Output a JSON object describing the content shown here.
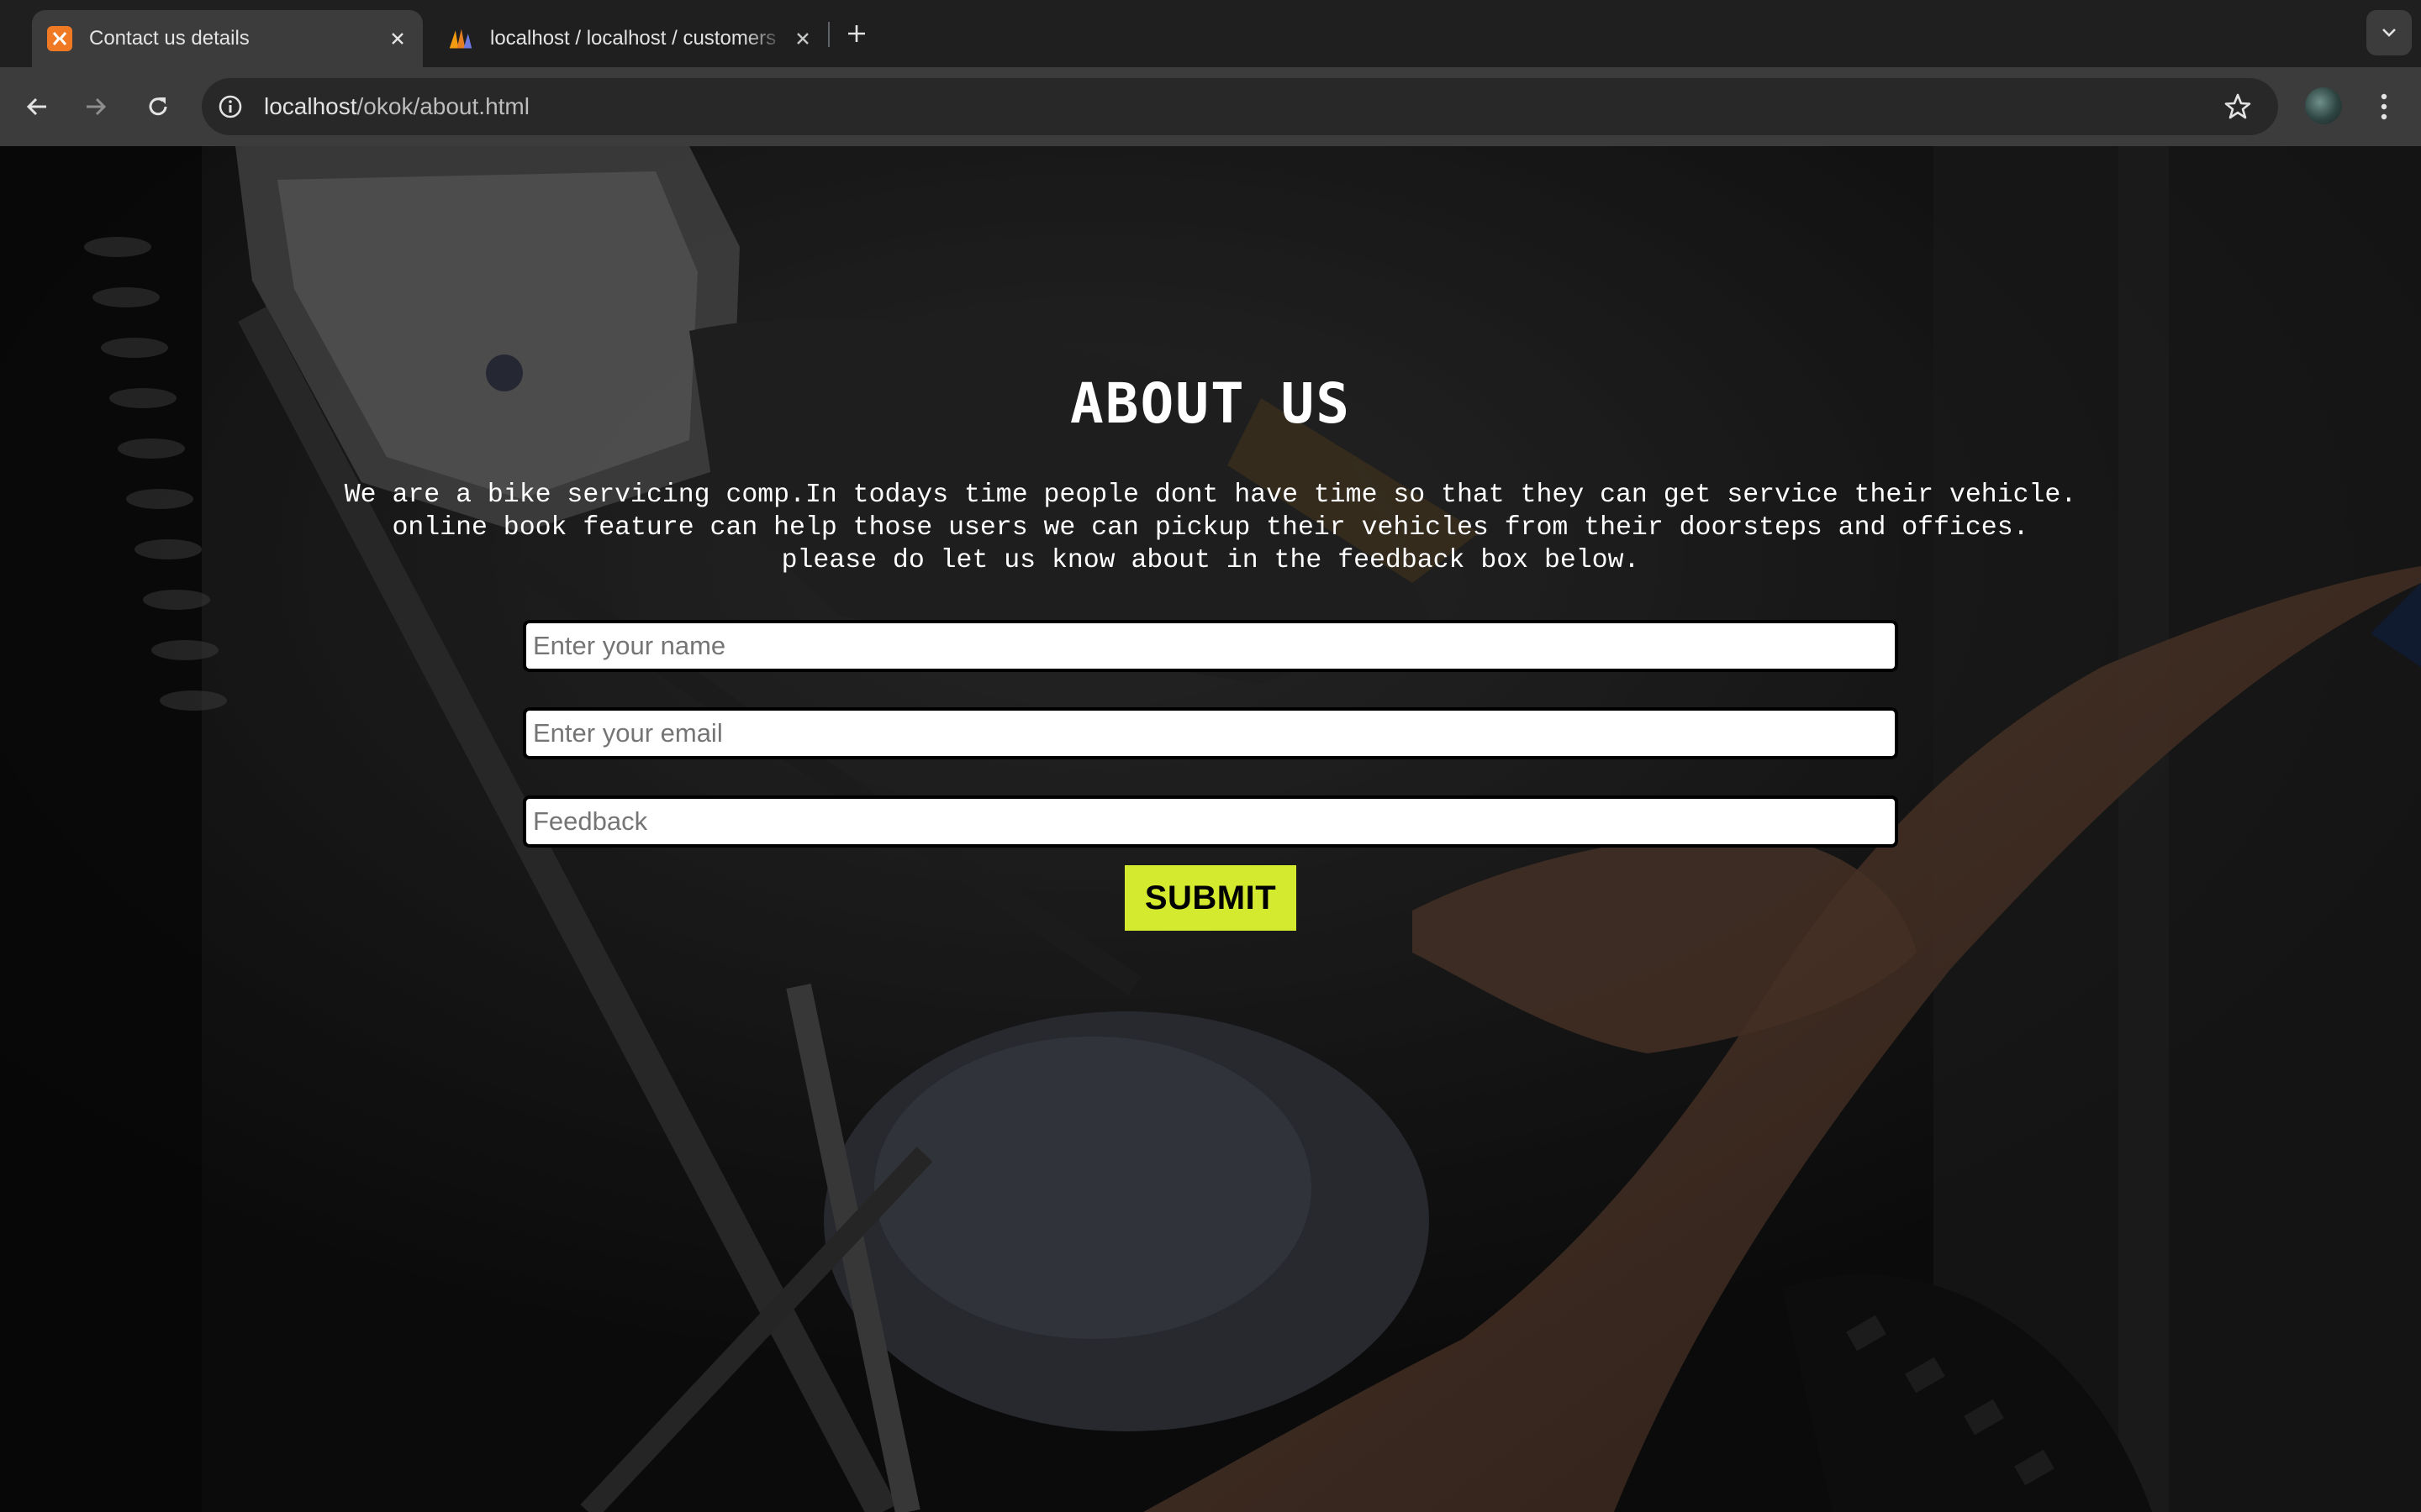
{
  "browser": {
    "tabs": [
      {
        "title": "Contact us details",
        "active": true,
        "favicon": "xampp-icon"
      },
      {
        "title": "localhost / localhost / customers",
        "active": false,
        "favicon": "phpmyadmin-icon"
      }
    ],
    "address_host": "localhost",
    "address_path": "/okok/about.html"
  },
  "page": {
    "heading": "ABOUT US",
    "about_lines": [
      "We are a bike servicing comp.In todays time people dont have time so that they can get service their vehicle.",
      "online book feature can help those users we can pickup their vehicles from their doorsteps and offices.",
      "please do let us know about in the feedback box below."
    ],
    "form": {
      "name_placeholder": "Enter your name",
      "email_placeholder": "Enter your email",
      "feedback_placeholder": "Feedback",
      "submit_label": "SUBMIT"
    }
  },
  "colors": {
    "submit_bg": "#d3ea2f",
    "tab_active_bg": "#3c3c3c",
    "xampp_orange": "#f07a24"
  }
}
